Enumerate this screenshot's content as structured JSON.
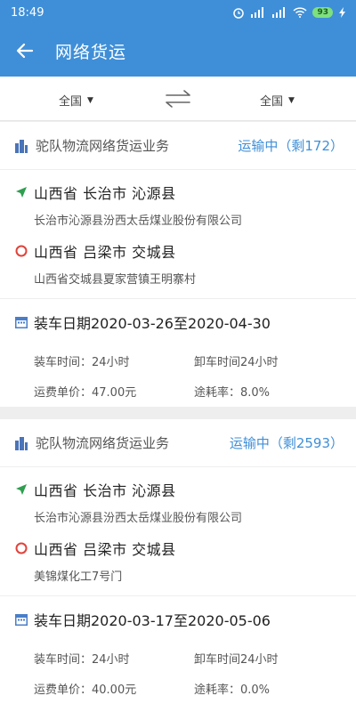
{
  "status_bar": {
    "time": "18:49",
    "battery": "93"
  },
  "app_bar": {
    "title": "网络货运"
  },
  "filters": {
    "from": "全国",
    "to": "全国"
  },
  "cards": [
    {
      "title": "驼队物流网络货运业务",
      "status": "运输中（剩172）",
      "origin_city": "山西省 长治市 沁源县",
      "origin_address": "长治市沁源县汾西太岳煤业股份有限公司",
      "dest_city": "山西省 吕梁市 交城县",
      "dest_address": "山西省交城县夏家营镇王明寨村",
      "loading_date": "装车日期2020-03-26至2020-04-30",
      "load_time": "装车时间：24小时",
      "unload_time": "卸车时间24小时",
      "unit_price": "运费单价：47.00元",
      "loss_rate": "途耗率：8.0%"
    },
    {
      "title": "驼队物流网络货运业务",
      "status": "运输中（剩2593）",
      "origin_city": "山西省 长治市 沁源县",
      "origin_address": "长治市沁源县汾西太岳煤业股份有限公司",
      "dest_city": "山西省 吕梁市 交城县",
      "dest_address": "美锦煤化工7号门",
      "loading_date": "装车日期2020-03-17至2020-05-06",
      "load_time": "装车时间：24小时",
      "unload_time": "卸车时间24小时",
      "unit_price": "运费单价：40.00元",
      "loss_rate": "途耗率：0.0%"
    }
  ],
  "colors": {
    "primary": "#3f8fd8",
    "origin_icon": "#2e9e4f",
    "dest_icon": "#e0433a"
  }
}
